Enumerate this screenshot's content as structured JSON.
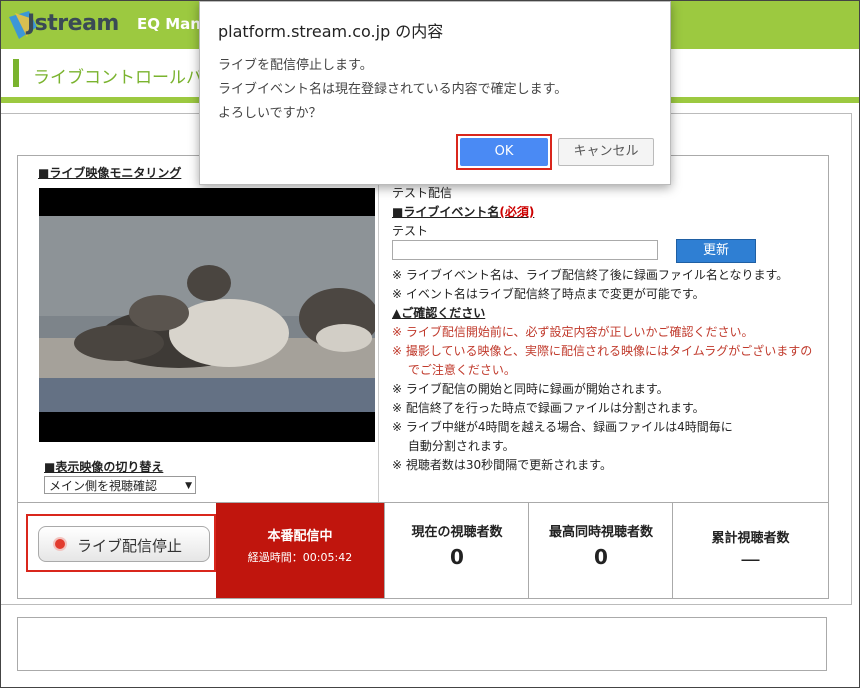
{
  "header": {
    "logo_text": "Jstream",
    "app_title": "EQ Man"
  },
  "subheader": {
    "title": "ライブコントロールパ"
  },
  "monitor": {
    "title": "■ライブ映像モニタリング",
    "switch_title": "■表示映像の切り替え",
    "select_value": "メイン側を視聴確認"
  },
  "right": {
    "test_label": "テスト配信",
    "event_name_heading": "■ライブイベント名",
    "required": "(必須)",
    "event_name_value": "テスト",
    "update_button": "更新",
    "notes1": [
      "※ ライブイベント名は、ライブ配信終了後に録画ファイル名となります。",
      "※ イベント名はライブ配信終了時点まで変更が可能です。"
    ],
    "confirm_heading": "▲ご確認ください",
    "red_notes": [
      "※ ライブ配信開始前に、必ず設定内容が正しいかご確認ください。",
      "※ 撮影している映像と、実際に配信される映像にはタイムラグがございますの",
      "　 でご注意ください。"
    ],
    "notes2": [
      "※ ライブ配信の開始と同時に録画が開始されます。",
      "※ 配信終了を行った時点で録画ファイルは分割されます。",
      "※ ライブ中継が4時間を越える場合、録画ファイルは4時間毎に",
      "　 自動分割されます。",
      "※ 視聴者数は30秒間隔で更新されます。"
    ]
  },
  "status": {
    "stop_button": "ライブ配信停止",
    "live_label": "本番配信中",
    "elapsed": "経過時間：00:05:42",
    "current_viewers_label": "現在の視聴者数",
    "current_viewers_value": "0",
    "peak_viewers_label": "最高同時視聴者数",
    "peak_viewers_value": "0",
    "total_viewers_label": "累計視聴者数",
    "total_viewers_value": "—"
  },
  "dialog": {
    "title": "platform.stream.co.jp の内容",
    "line1": "ライブを配信停止します。",
    "line2": "ライブイベント名は現在登録されている内容で確定します。",
    "line3": "よろしいですか？",
    "ok": "OK",
    "cancel": "キャンセル"
  },
  "colors": {
    "header_green": "#9cc940",
    "live_red": "#c0150d",
    "ok_blue": "#4a8af4",
    "highlight_red": "#d9261c"
  }
}
